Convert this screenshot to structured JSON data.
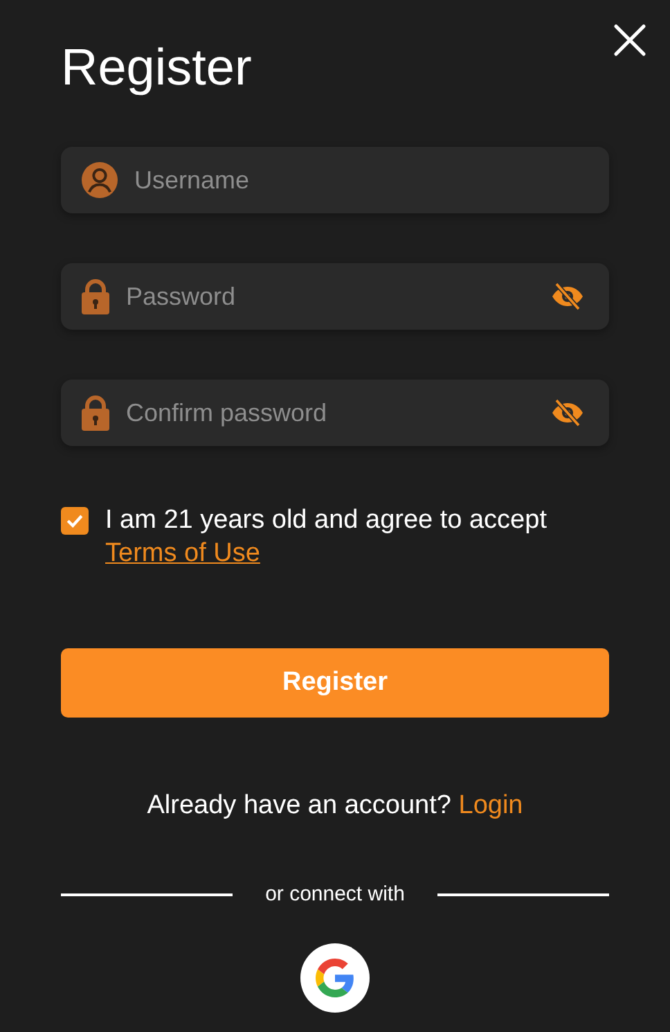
{
  "title": "Register",
  "fields": [
    {
      "kind": "username",
      "placeholder": "Username"
    },
    {
      "kind": "password",
      "placeholder": "Password"
    },
    {
      "kind": "password",
      "placeholder": "Confirm password"
    }
  ],
  "agreement": {
    "checked": true,
    "text": "I am 21 years old and agree to accept",
    "link": "Terms of Use"
  },
  "submit": "Register",
  "login_prompt": {
    "text": "Already have an account?",
    "link": "Login"
  },
  "divider_text": "or connect with"
}
